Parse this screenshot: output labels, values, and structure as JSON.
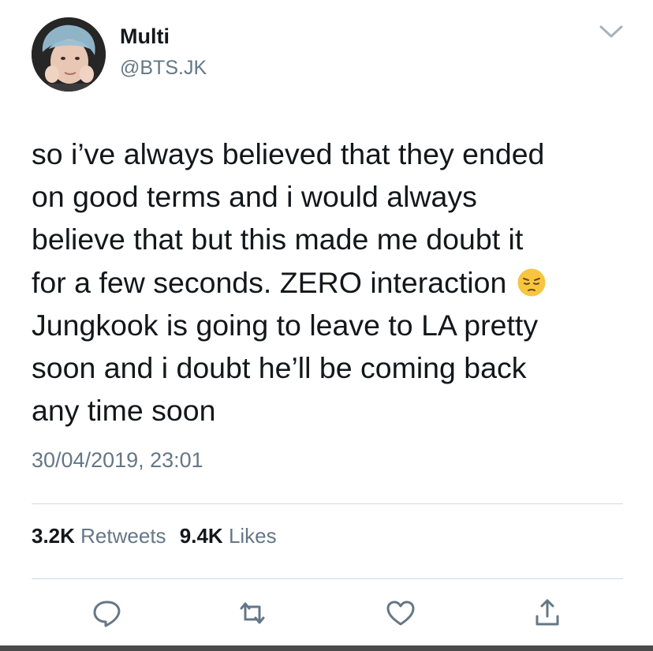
{
  "user": {
    "display_name": "Multi",
    "handle": "@BTS.JK",
    "avatar": "profile-photo"
  },
  "tweet": {
    "text_before_emoji": "so i’ve always believed that they ended\non good terms and i would always\nbelieve that but this made me doubt it\nfor a few seconds. ZERO interaction ",
    "emoji": "pensive-face",
    "text_after_emoji": "\nJungkook is going to leave to LA pretty\nsoon and i doubt he’ll be coming back\nany time soon",
    "timestamp": "30/04/2019, 23:01"
  },
  "stats": {
    "retweets_count": "3.2K",
    "retweets_label": "Retweets",
    "likes_count": "9.4K",
    "likes_label": "Likes"
  },
  "actions": {
    "icons": [
      "reply-icon",
      "retweet-icon",
      "like-icon",
      "share-icon"
    ]
  },
  "colors": {
    "text": "#14171a",
    "secondary": "#657786",
    "divider": "#d4d9dd"
  }
}
